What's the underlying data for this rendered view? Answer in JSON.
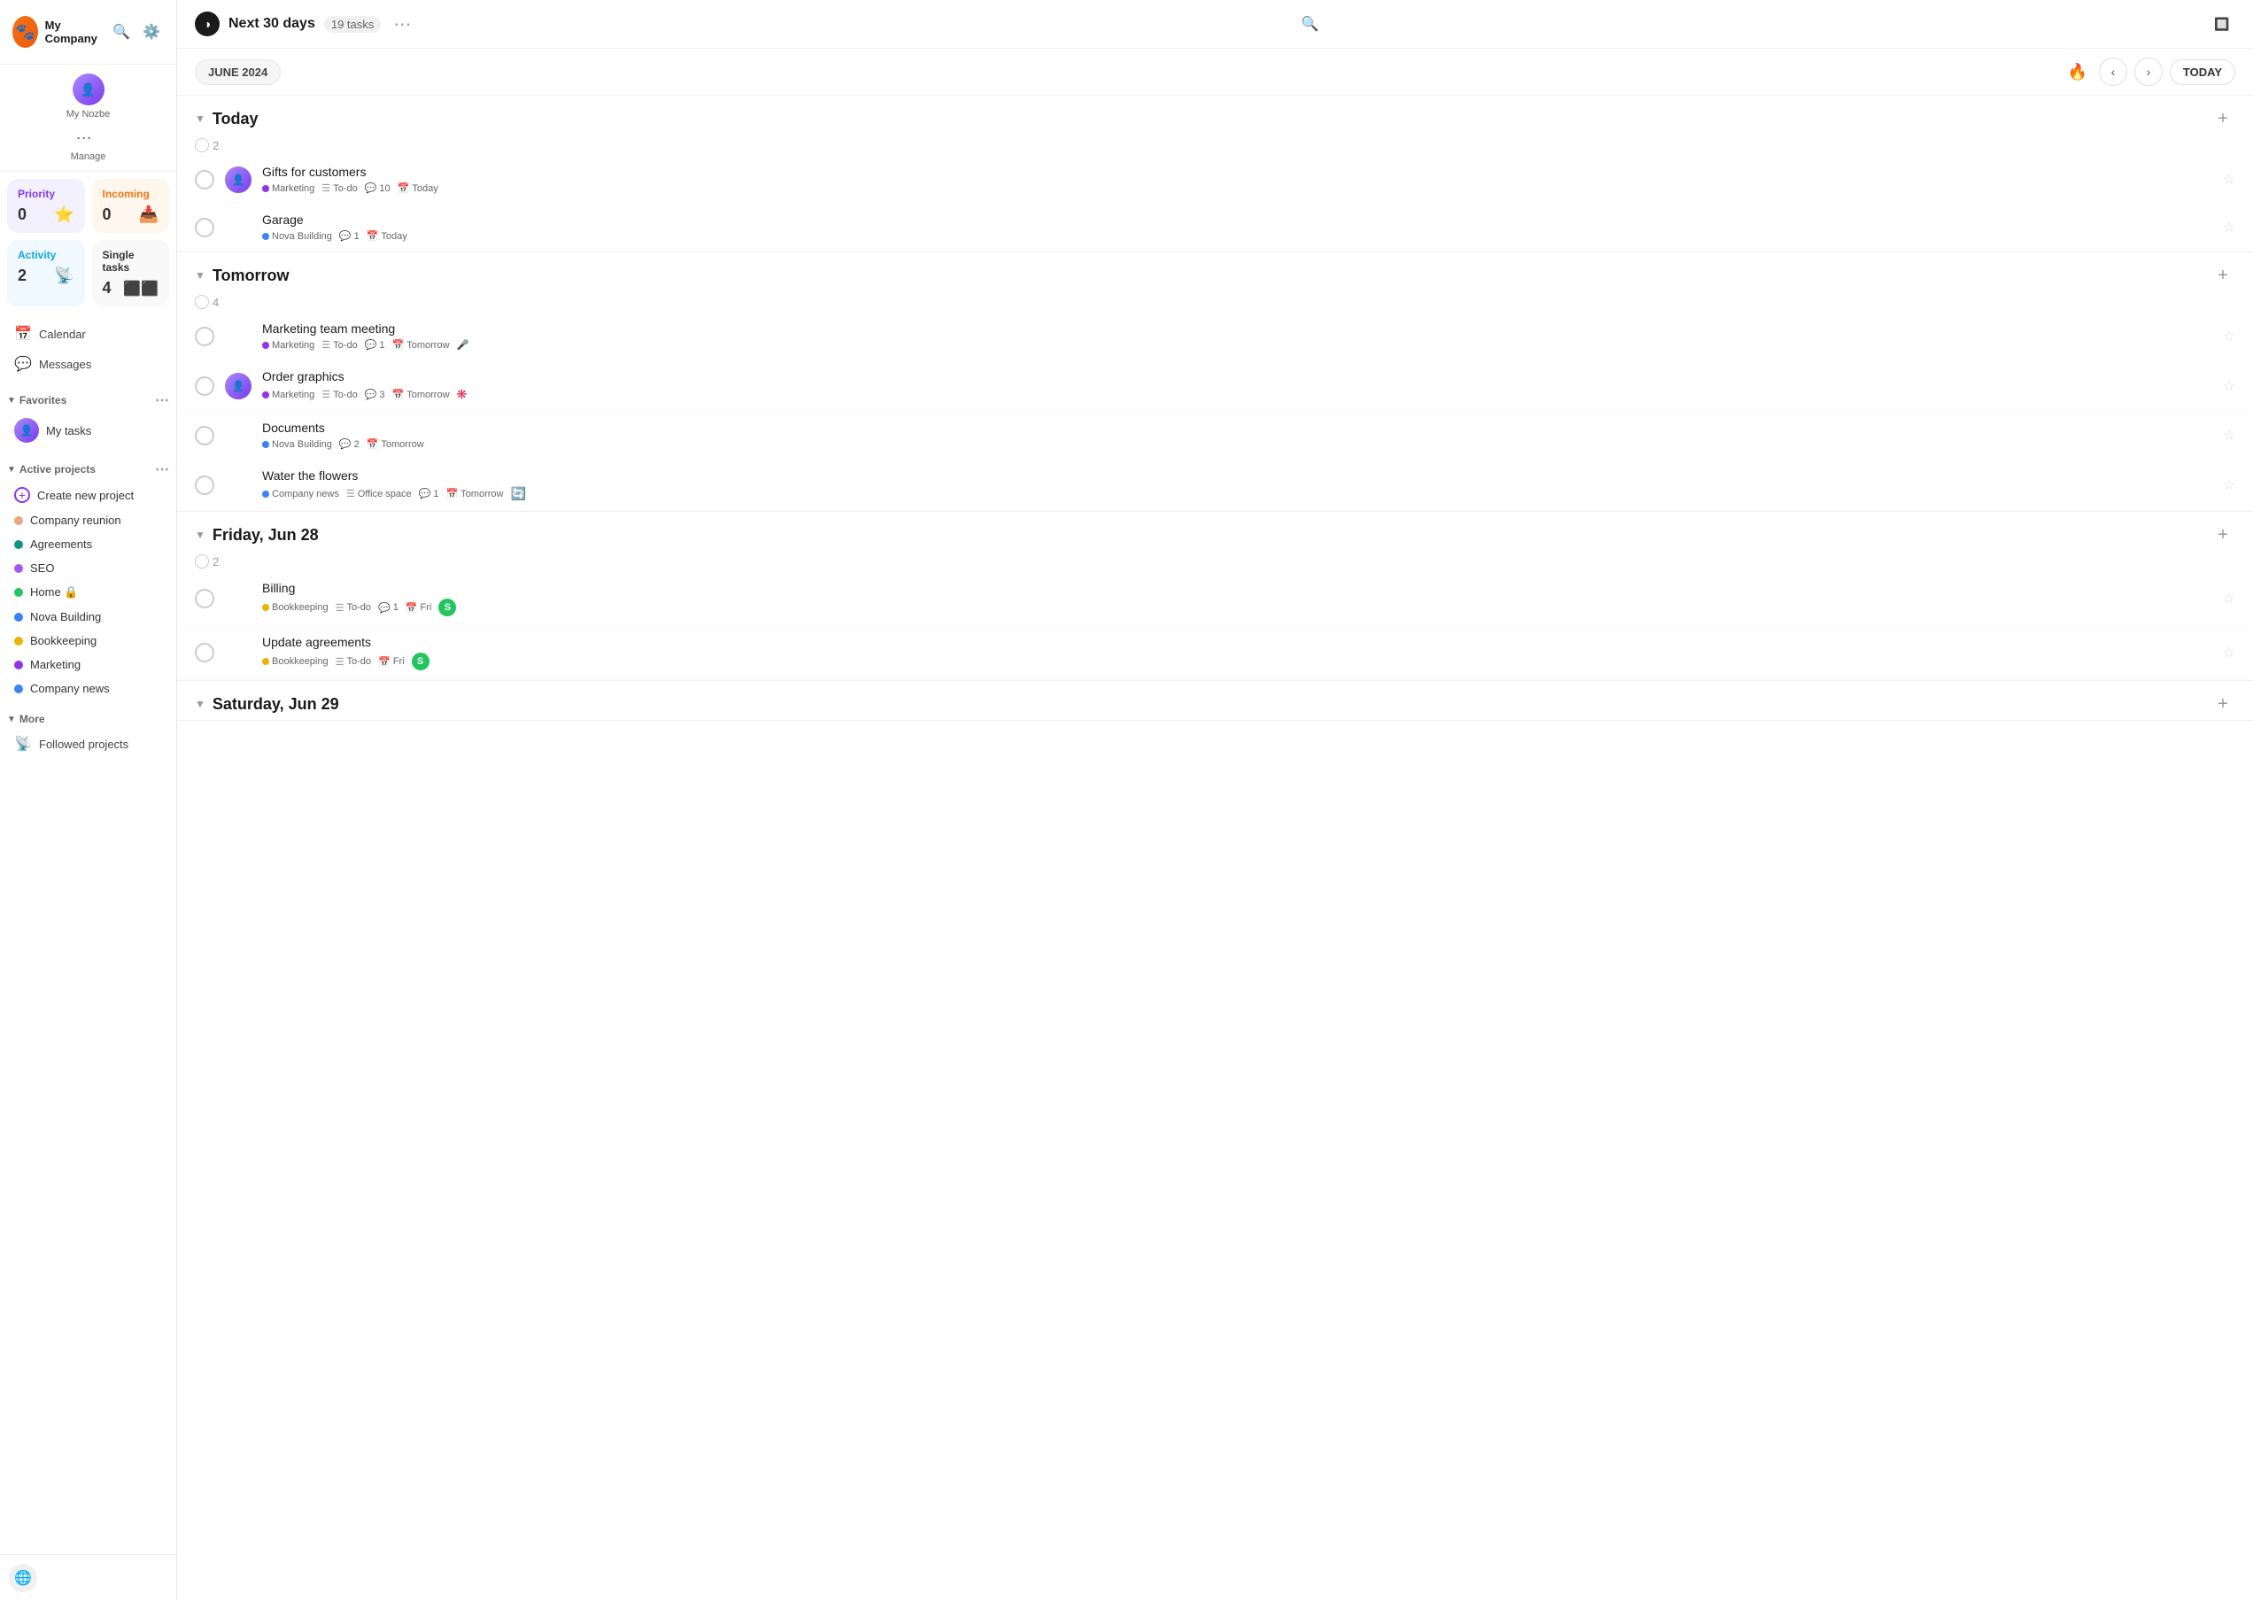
{
  "sidebar": {
    "company_name": "My Company",
    "user_name": "My Nozbe",
    "manage_label": "Manage",
    "nav_items": [
      {
        "id": "calendar",
        "label": "Calendar",
        "icon": "📅"
      },
      {
        "id": "messages",
        "label": "Messages",
        "icon": "💬"
      }
    ],
    "stats": {
      "priority": {
        "label": "Priority",
        "value": "0",
        "icon": "⭐"
      },
      "incoming": {
        "label": "Incoming",
        "value": "0",
        "icon": "📥"
      },
      "activity": {
        "label": "Activity",
        "value": "2",
        "icon": "📡"
      },
      "single_tasks": {
        "label": "Single tasks",
        "value": "4",
        "icon": "⬛⬛"
      }
    },
    "favorites_label": "Favorites",
    "my_tasks_label": "My tasks",
    "active_projects_label": "Active projects",
    "create_project_label": "Create new project",
    "projects": [
      {
        "id": "company-reunion",
        "label": "Company reunion",
        "color": "#e8a87c"
      },
      {
        "id": "agreements",
        "label": "Agreements",
        "color": "#0d9488"
      },
      {
        "id": "seo",
        "label": "SEO",
        "color": "#a855f7"
      },
      {
        "id": "home",
        "label": "Home 🔒",
        "color": "#22c55e"
      },
      {
        "id": "nova-building",
        "label": "Nova Building",
        "color": "#3b82f6"
      },
      {
        "id": "bookkeeping",
        "label": "Bookkeeping",
        "color": "#eab308"
      },
      {
        "id": "marketing",
        "label": "Marketing",
        "color": "#9333ea"
      },
      {
        "id": "company-news",
        "label": "Company news",
        "color": "#3b82f6"
      }
    ],
    "more_label": "More",
    "followed_projects_label": "Followed projects"
  },
  "main": {
    "view_icon": "◑",
    "title": "Next 30 days",
    "task_count": "19 tasks",
    "date_badge": "JUNE 2024",
    "today_btn": "TODAY",
    "sections": [
      {
        "id": "today",
        "title": "Today",
        "count": "2",
        "tasks": [
          {
            "id": "gifts",
            "name": "Gifts for customers",
            "project": "Marketing",
            "project_color": "#9333ea",
            "section": "To-do",
            "comments": "10",
            "due": "Today",
            "has_avatar": true
          },
          {
            "id": "garage",
            "name": "Garage",
            "project": "Nova Building",
            "project_color": "#3b82f6",
            "section": null,
            "comments": "1",
            "due": "Today",
            "has_avatar": false
          }
        ]
      },
      {
        "id": "tomorrow",
        "title": "Tomorrow",
        "count": "4",
        "tasks": [
          {
            "id": "marketing-meeting",
            "name": "Marketing team meeting",
            "project": "Marketing",
            "project_color": "#9333ea",
            "section": "To-do",
            "comments": "1",
            "due": "Tomorrow",
            "has_avatar": false,
            "extra_icon": "🎤"
          },
          {
            "id": "order-graphics",
            "name": "Order graphics",
            "project": "Marketing",
            "project_color": "#9333ea",
            "section": "To-do",
            "comments": "3",
            "due": "Tomorrow",
            "has_avatar": true,
            "extra_icon": "❇️"
          },
          {
            "id": "documents",
            "name": "Documents",
            "project": "Nova Building",
            "project_color": "#3b82f6",
            "section": null,
            "comments": "2",
            "due": "Tomorrow",
            "has_avatar": false
          },
          {
            "id": "water-flowers",
            "name": "Water the flowers",
            "project": "Company news",
            "project_color": "#3b82f6",
            "section": "Office space",
            "comments": "1",
            "due": "Tomorrow",
            "has_avatar": false,
            "extra_icon": "🔄"
          }
        ]
      },
      {
        "id": "friday-jun28",
        "title": "Friday, Jun 28",
        "count": "2",
        "tasks": [
          {
            "id": "billing",
            "name": "Billing",
            "project": "Bookkeeping",
            "project_color": "#eab308",
            "section": "To-do",
            "comments": "1",
            "due": "Fri",
            "has_avatar": false,
            "extra_icon": "🅢"
          },
          {
            "id": "update-agreements",
            "name": "Update agreements",
            "project": "Bookkeeping",
            "project_color": "#eab308",
            "section": "To-do",
            "comments": null,
            "due": "Fri",
            "has_avatar": false,
            "extra_icon": "🅢"
          }
        ]
      },
      {
        "id": "saturday-jun29",
        "title": "Saturday, Jun 29",
        "count": null,
        "tasks": []
      }
    ]
  }
}
